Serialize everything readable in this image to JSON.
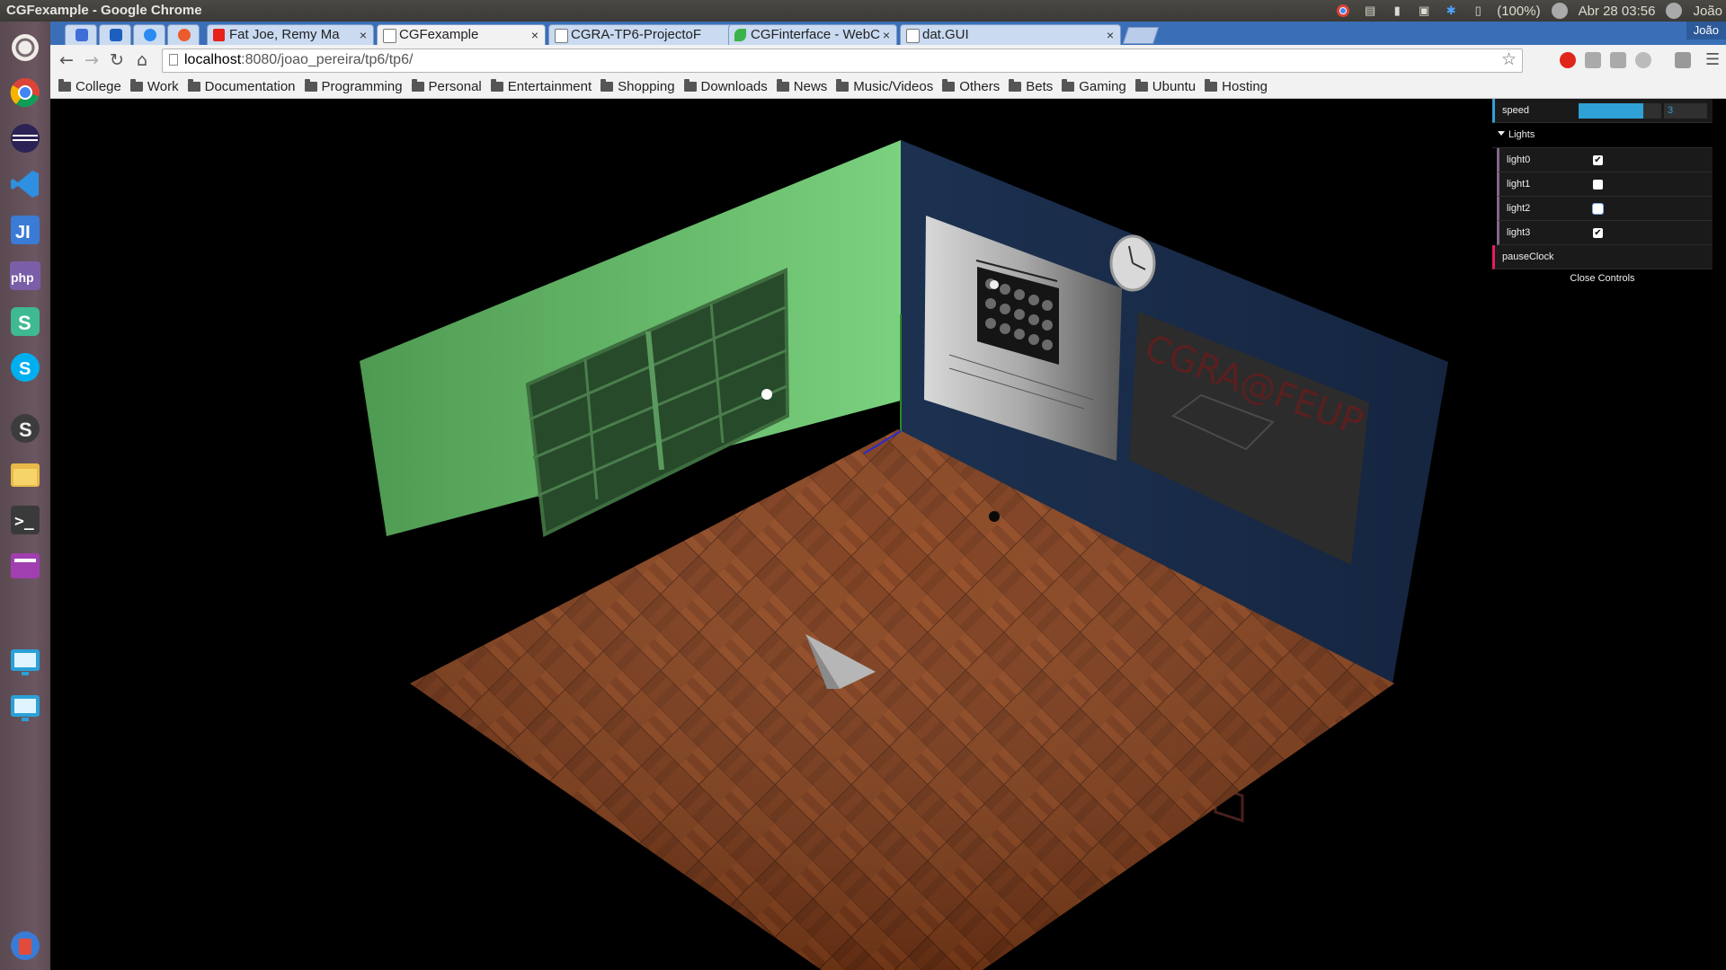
{
  "window": {
    "title": "CGFexample - Google Chrome"
  },
  "panel": {
    "battery": "(100%)",
    "datetime": "Abr 28 03:56",
    "user": "João"
  },
  "tabs": [
    {
      "label": "Fat Joe, Remy Ma",
      "icon": "youtube-icon"
    },
    {
      "label": "CGFexample",
      "active": true,
      "icon": "page-icon"
    },
    {
      "label": "CGRA-TP6-ProjectoF",
      "icon": "page-icon"
    },
    {
      "label": "CGFinterface - WebC",
      "icon": "leaf-icon"
    },
    {
      "label": "dat.GUI",
      "icon": "page-icon"
    }
  ],
  "tab_close": "×",
  "chrome_user": "João",
  "address": {
    "host": "localhost",
    "path": ":8080/joao_pereira/tp6/tp6/"
  },
  "bookmarks": [
    "College",
    "Work",
    "Documentation",
    "Programming",
    "Personal",
    "Entertainment",
    "Shopping",
    "Downloads",
    "News",
    "Music/Videos",
    "Others",
    "Bets",
    "Gaming",
    "Ubuntu",
    "Hosting"
  ],
  "gui": {
    "speed_label": "speed",
    "speed_value": "3",
    "speed_fraction": 0.78,
    "folder_label": "Lights",
    "lights": [
      {
        "label": "light0",
        "checked": true
      },
      {
        "label": "light1",
        "checked": false
      },
      {
        "label": "light2",
        "checked": false
      },
      {
        "label": "light3",
        "checked": true
      }
    ],
    "pause_label": "pauseClock",
    "close_label": "Close Controls"
  },
  "scene": {
    "board_text": "CGRA@FEUP",
    "wall_left_color": "#7ad17e",
    "wall_right_color": "#1c3150",
    "floor_color": "#7a3513"
  }
}
